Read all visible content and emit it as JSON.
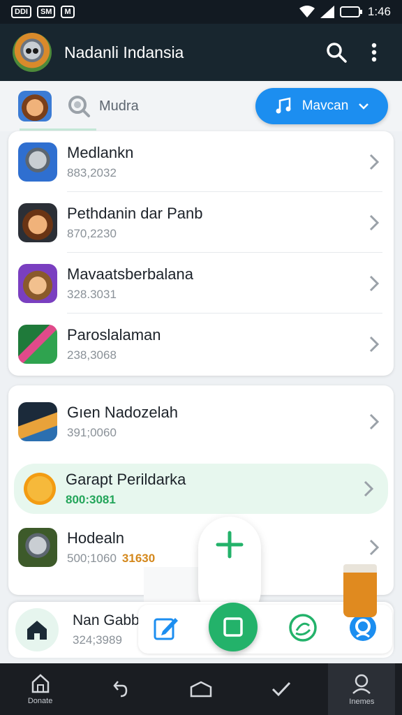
{
  "status": {
    "time": "1:46",
    "notif_left": [
      "DDI",
      "SM",
      "M"
    ]
  },
  "appbar": {
    "title": "Nadanli Indansia",
    "search_icon": "search-icon",
    "menu_icon": "more-vert-icon"
  },
  "filter": {
    "search_label": "Mudra",
    "music_button": "Mavcan",
    "colors": {
      "accent": "#1c8ef0"
    }
  },
  "list1": [
    {
      "title": "Medlankn",
      "sub": "883,2032"
    },
    {
      "title": "Pethdanin dar Panb",
      "sub": "870,2230"
    },
    {
      "title": "Mavaatsberbalana",
      "sub": "328.3031"
    },
    {
      "title": "Paroslalaman",
      "sub": "238,3068"
    }
  ],
  "list2": [
    {
      "title": "Gıen Nadozelah",
      "sub": "391;0060"
    },
    {
      "title": "Garapt Perildarka",
      "sub": "800:3081"
    },
    {
      "title": "Hodealn",
      "sub": "500;1060",
      "badge": "31630"
    }
  ],
  "bottom_item": {
    "title": "Nan Gabbe",
    "sub": "324;3989"
  },
  "nav": {
    "left_label": "Donate",
    "right_label": "Inemes"
  }
}
